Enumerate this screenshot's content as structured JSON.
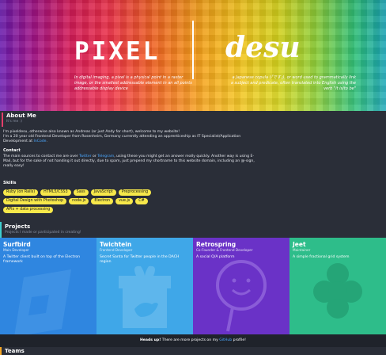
{
  "hero": {
    "logo_left": "PIXEL",
    "logo_right": "desu",
    "left_text": "In digital imaging, a pixel is a physical point in a raster image, or the smallest addressable element in an all points addressable display device",
    "right_text": "a Japanese copula (「です」), or word used to grammatically link a subject and predicate, often translated into English using the verb \"it is/to be\""
  },
  "about": {
    "title": "About Me",
    "subtitle": "It's me :)",
    "intro_1": "I'm pixeldesu, otherwise also known as Andreas (or just Andy for short), welcome to my website!",
    "intro_2": "I'm a 20 year old Frontend Developer from Rosenheim, Germany currently attending an apprenticeship as IT Specialist/Application Development at",
    "employer": "InCode",
    "contact_title": "Contact",
    "contact_1": "The main sources to contact me are over",
    "twitter": "Twitter",
    "or": "or",
    "telegram": "Telegram",
    "contact_2": ", using these you might get an answer really quickly. Another way is using E-Mail, but for the sake of not handing it out directly, due to spam, just prepend my shortname to this website domain, including an @-sign, really easy!",
    "skills_title": "Skills",
    "skills": [
      "Ruby (on Rails)",
      "HTML5/CSS3",
      "Sass",
      "JavaScript",
      "Preprocessing",
      "Digital Design with Photoshop",
      "node.js",
      "Electron",
      "vue.js",
      "C#",
      "APIs + data processing"
    ]
  },
  "projects": {
    "title": "Projects",
    "subtitle": "Projects I made or participated in creating!",
    "items": [
      {
        "name": "Surfbird",
        "role": "Main Developer",
        "desc": "A Twitter client built on top of the Electron framework",
        "color": "#2f86e0"
      },
      {
        "name": "Twichtein",
        "role": "Frontend Developer",
        "desc": "Secret Santa for Twitter people in the DACH region",
        "color": "#3fa7e8"
      },
      {
        "name": "Retrospring",
        "role": "Co-Founder & Frontend Developer",
        "desc": "A social Q/A platform",
        "color": "#6a32c7"
      },
      {
        "name": "Jeet",
        "role": "Maintainer",
        "desc": "A simple fractional grid system",
        "color": "#2ebd8a"
      }
    ]
  },
  "notice": {
    "bold": "Heads up!",
    "text": "There are more projects on my",
    "link": "GitHub",
    "after": "profile!"
  },
  "teams": {
    "title": "Teams"
  }
}
